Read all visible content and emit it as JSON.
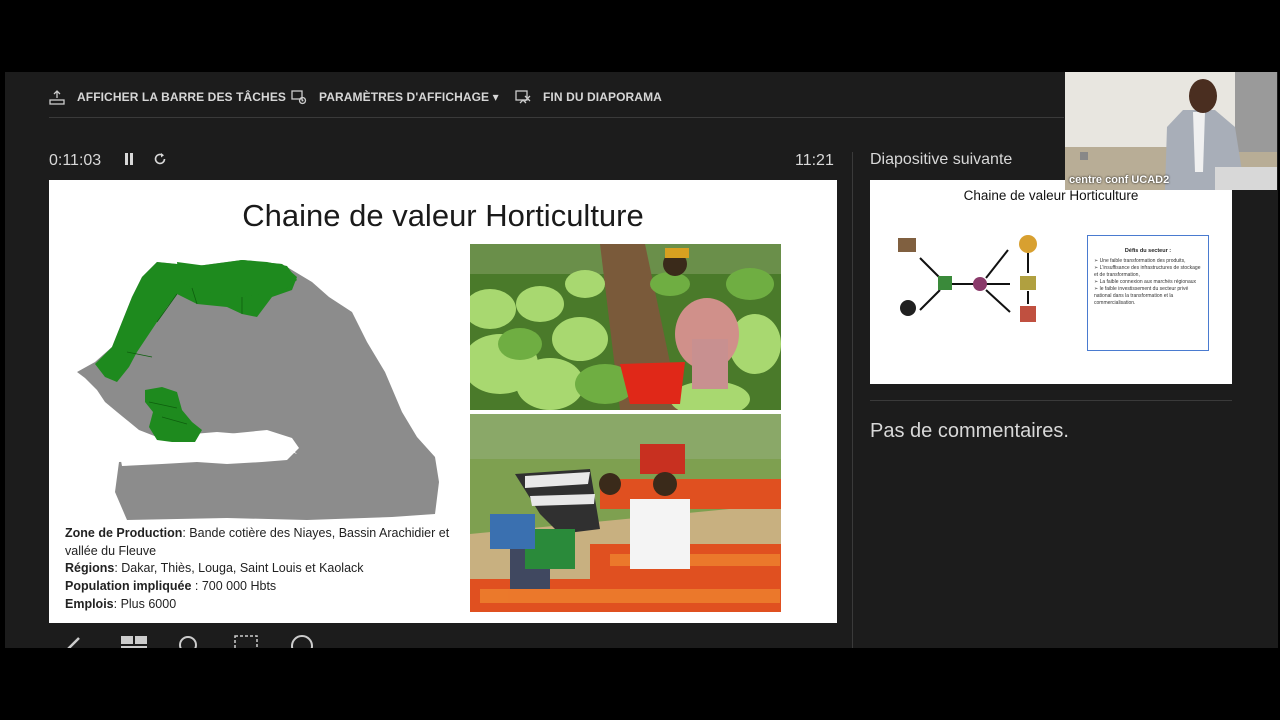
{
  "toolbar": {
    "taskbar_label": "AFFICHER LA BARRE DES TÂCHES",
    "display_settings_label": "PARAMÈTRES D'AFFICHAGE ▾",
    "end_slideshow_label": "FIN DU DIAPORAMA"
  },
  "timer": {
    "elapsed": "0:11:03",
    "clock": "11:21"
  },
  "current_slide": {
    "title": "Chaine de valeur Horticulture",
    "zone_label": "Zone de Production",
    "zone_value": ": Bande cotière des Niayes, Bassin Arachidier et vallée du Fleuve",
    "regions_label": "Régions",
    "regions_value": ": Dakar, Thiès, Louga, Saint Louis et Kaolack",
    "population_label": "Population impliquée",
    "population_value": " : 700 000 Hbts",
    "jobs_label": "Emplois",
    "jobs_value": ":  Plus 6000"
  },
  "next_panel": {
    "label": "Diapositive suivante",
    "slide_title": "Chaine de valeur Horticulture",
    "box_title": "Défis du secteur :",
    "box_items": [
      "➢ Une faible transformation des produits,",
      "➢ L'insuffisance des infrastructures de stockage et de transformation,",
      "➢ La faible connexion aux marchés régionaux",
      "➢ le faible investissement du secteur privé national dans la transformation et la commercialisation."
    ]
  },
  "notes": {
    "text": "Pas de commentaires."
  },
  "webcam": {
    "label": "centre conf UCAD2"
  },
  "colors": {
    "map_green": "#1e8a1e",
    "map_grey": "#8c8c8c",
    "background": "#1c1c1c"
  }
}
